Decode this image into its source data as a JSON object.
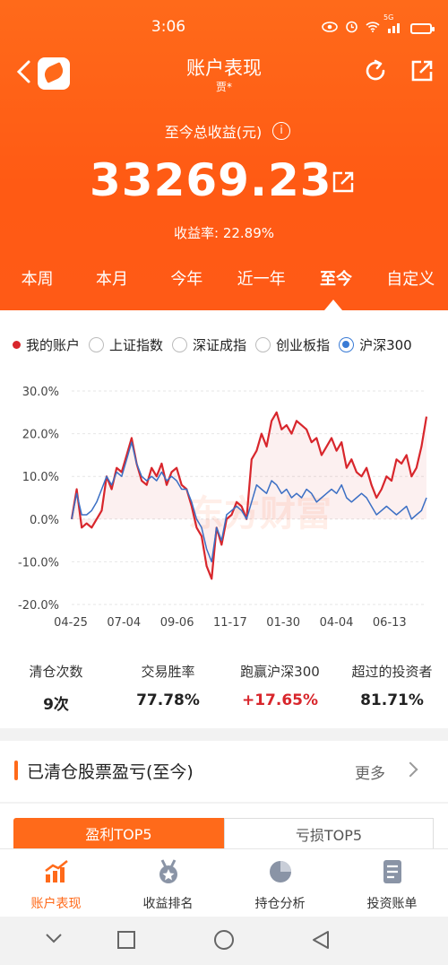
{
  "status_bar": {
    "time": "3:06",
    "network": "5G"
  },
  "nav": {
    "title": "账户表现",
    "subtitle": "贾*"
  },
  "summary": {
    "total_label": "至今总收益(元)",
    "info": "i",
    "total_value": "33269.23",
    "rate_label": "收益率:",
    "rate_value": "22.89%"
  },
  "periods": [
    "本周",
    "本月",
    "今年",
    "近一年",
    "至今",
    "自定义"
  ],
  "active_period": "至今",
  "legend": {
    "my_account": "我的账户",
    "options": [
      "上证指数",
      "深证成指",
      "创业板指",
      "沪深300"
    ],
    "selected": "沪深300"
  },
  "watermark": "东方财富",
  "chart_data": {
    "type": "line",
    "ylim": [
      -20,
      30
    ],
    "yticks": [
      "30.0%",
      "20.0%",
      "10.0%",
      "0.0%",
      "-10.0%",
      "-20.0%"
    ],
    "xticks": [
      "04-25",
      "07-04",
      "09-06",
      "11-17",
      "01-30",
      "04-04",
      "06-13"
    ],
    "series": [
      {
        "name": "我的账户",
        "color": "#d8262c",
        "values": [
          0,
          7,
          -2,
          -1,
          -2,
          0,
          2,
          10,
          7,
          12,
          11,
          15,
          19,
          13,
          9,
          8,
          12,
          10,
          13,
          8,
          11,
          12,
          8,
          7,
          3,
          -2,
          -4,
          -11,
          -14,
          -2,
          -6,
          0,
          1,
          4,
          3,
          0,
          14,
          16,
          20,
          17,
          23,
          25,
          21,
          22,
          20,
          23,
          22,
          21,
          18,
          19,
          15,
          17,
          19,
          16,
          18,
          12,
          14,
          11,
          10,
          12,
          8,
          5,
          7,
          10,
          9,
          14,
          13,
          15,
          10,
          12,
          17,
          24
        ]
      },
      {
        "name": "沪深300",
        "color": "#3b6fc4",
        "values": [
          0,
          6,
          1,
          1,
          2,
          4,
          7,
          10,
          8,
          11,
          10,
          14,
          18,
          13,
          10,
          9,
          10,
          9,
          11,
          9,
          10,
          9,
          7,
          7,
          4,
          0,
          -2,
          -7,
          -10,
          -2,
          -5,
          1,
          2,
          3,
          2,
          0,
          4,
          8,
          7,
          6,
          9,
          8,
          6,
          7,
          5,
          6,
          5,
          7,
          6,
          4,
          5,
          6,
          7,
          6,
          8,
          5,
          4,
          5,
          6,
          5,
          3,
          1,
          2,
          3,
          2,
          1,
          2,
          3,
          0,
          1,
          2,
          5
        ]
      }
    ]
  },
  "stats": [
    {
      "label": "清仓次数",
      "value": "9次"
    },
    {
      "label": "交易胜率",
      "value": "77.78%"
    },
    {
      "label": "跑赢沪深300",
      "value": "+17.65%"
    },
    {
      "label": "超过的投资者",
      "value": "81.71%"
    }
  ],
  "cleared_section": {
    "title": "已清仓股票盈亏(至今)",
    "more": "更多"
  },
  "pl_tabs": {
    "profit": "盈利TOP5",
    "loss": "亏损TOP5"
  },
  "bottom_nav": [
    {
      "label": "账户表现",
      "icon": "chart-up-icon",
      "active": true
    },
    {
      "label": "收益排名",
      "icon": "medal-icon",
      "active": false
    },
    {
      "label": "持仓分析",
      "icon": "pie-chart-icon",
      "active": false
    },
    {
      "label": "投资账单",
      "icon": "bill-icon",
      "active": false
    }
  ],
  "colors": {
    "brand": "#ff6a1a",
    "up": "#d8262c",
    "index_line": "#3b6fc4"
  }
}
